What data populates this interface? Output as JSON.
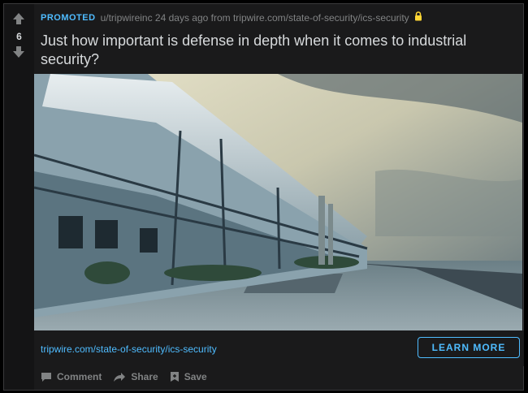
{
  "post": {
    "votes": "6",
    "promoted_label": "PROMOTED",
    "meta_text": "u/tripwireinc 24 days ago from tripwire.com/state-of-security/ics-security",
    "title": "Just how important is defense in depth when it comes to industrial security?",
    "link_text": "tripwire.com/state-of-security/ics-security",
    "cta_label": "LEARN MORE",
    "actions": {
      "comment": "Comment",
      "share": "Share",
      "save": "Save"
    }
  },
  "colors": {
    "accent": "#4fbcff",
    "text": "#d7dadc",
    "muted": "#818384",
    "card_bg": "#1a1a1b",
    "lock": "#ffd635"
  },
  "icons": [
    "upvote-icon",
    "downvote-icon",
    "lock-icon",
    "comment-icon",
    "share-icon",
    "save-icon"
  ]
}
